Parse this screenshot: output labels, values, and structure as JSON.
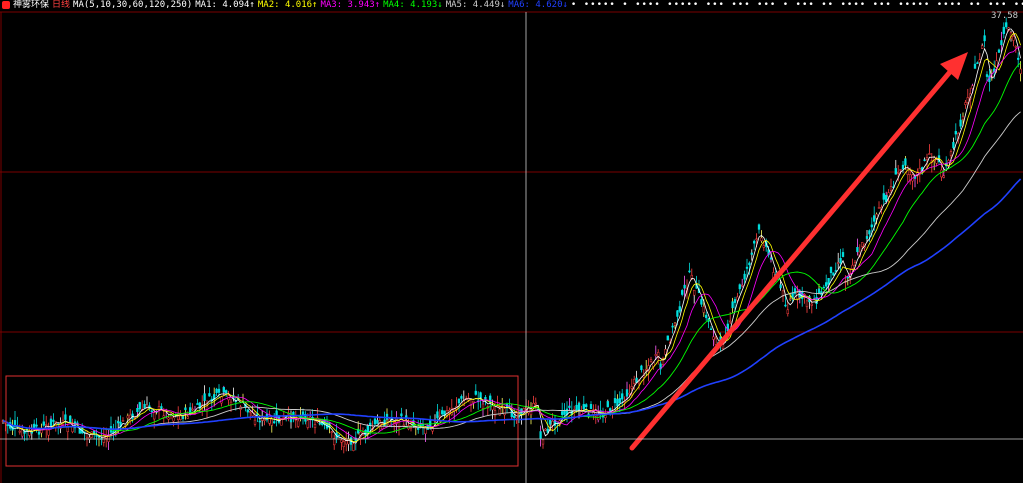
{
  "header": {
    "stock_name": "神雾环保",
    "period": "日线",
    "ma_params": "MA(5,10,30,60,120,250)",
    "ma1": "MA1: 4.094↑",
    "ma2": "MA2: 4.016↑",
    "ma3": "MA3: 3.943↑",
    "ma4": "MA4: 4.193↓",
    "ma5": "MA5: 4.449↓",
    "ma6": "MA6: 4.620↓"
  },
  "price_high_label": "37.58",
  "colors": {
    "background": "#000000",
    "ma1": "#ffffff",
    "ma2": "#ffff00",
    "ma3": "#ff00ff",
    "ma4": "#00ff00",
    "ma5": "#cccccc",
    "ma6": "#2040ff",
    "grid": "#7a0000",
    "box": "#e03030",
    "arrow": "#ff3030",
    "crosshair": "#cccccc"
  },
  "icons": {
    "arrow": "up-right-trend-arrow",
    "box": "consolidation-box"
  }
}
